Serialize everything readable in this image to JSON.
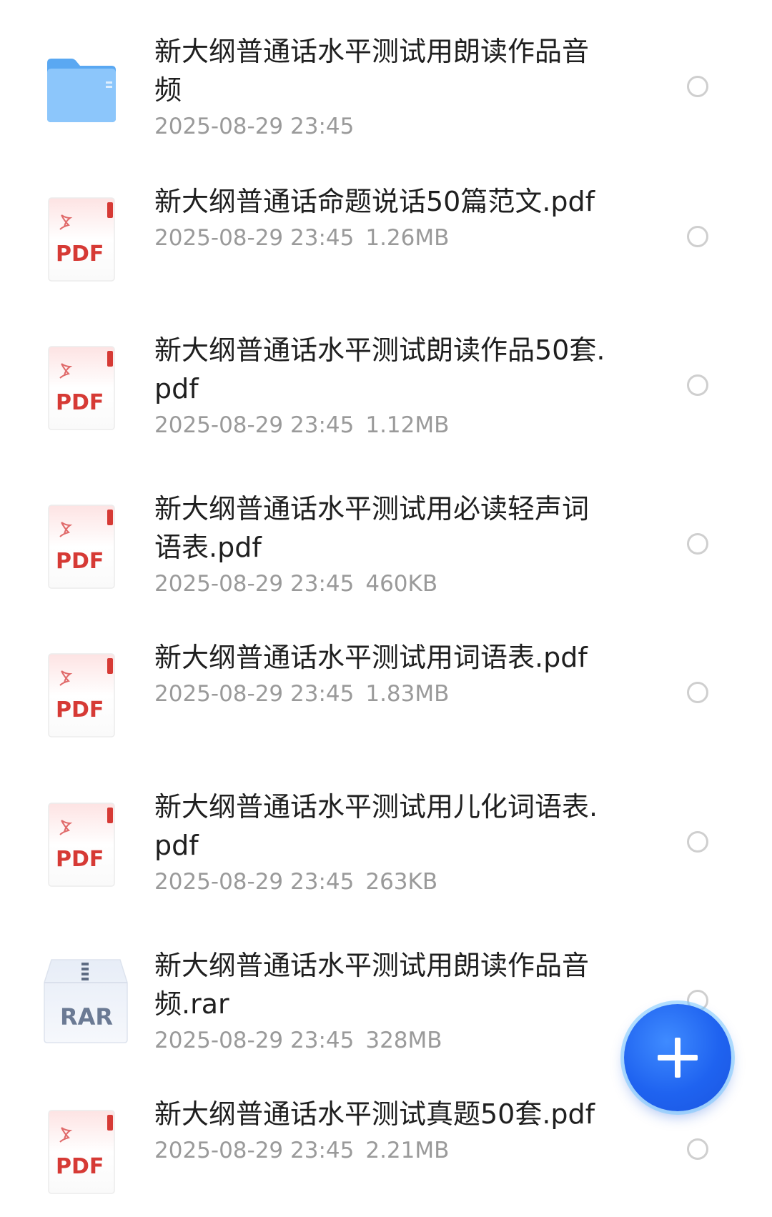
{
  "files": [
    {
      "type": "folder",
      "name": "新大纲普通话水平测试用朗读作品音频",
      "date": "2025-08-29 23:45",
      "size": ""
    },
    {
      "type": "pdf",
      "name": "新大纲普通话命题说话50篇范文.pdf",
      "date": "2025-08-29 23:45",
      "size": "1.26MB"
    },
    {
      "type": "pdf",
      "name": "新大纲普通话水平测试朗读作品50套.pdf",
      "date": "2025-08-29 23:45",
      "size": "1.12MB"
    },
    {
      "type": "pdf",
      "name": "新大纲普通话水平测试用必读轻声词语表.pdf",
      "date": "2025-08-29 23:45",
      "size": "460KB"
    },
    {
      "type": "pdf",
      "name": "新大纲普通话水平测试用词语表.pdf",
      "date": "2025-08-29 23:45",
      "size": "1.83MB"
    },
    {
      "type": "pdf",
      "name": "新大纲普通话水平测试用儿化词语表.pdf",
      "date": "2025-08-29 23:45",
      "size": "263KB"
    },
    {
      "type": "rar",
      "name": "新大纲普通话水平测试用朗读作品音频.rar",
      "date": "2025-08-29 23:45",
      "size": "328MB"
    },
    {
      "type": "pdf",
      "name": "新大纲普通话水平测试真题50套.pdf",
      "date": "2025-08-29 23:45",
      "size": "2.21MB"
    }
  ],
  "icons": {
    "pdf_label": "PDF",
    "rar_label": "RAR",
    "add": "plus-icon"
  },
  "colors": {
    "folder": "#5aa8f2",
    "pdf_red": "#d63a35",
    "fab_blue": "#1f63f0"
  }
}
